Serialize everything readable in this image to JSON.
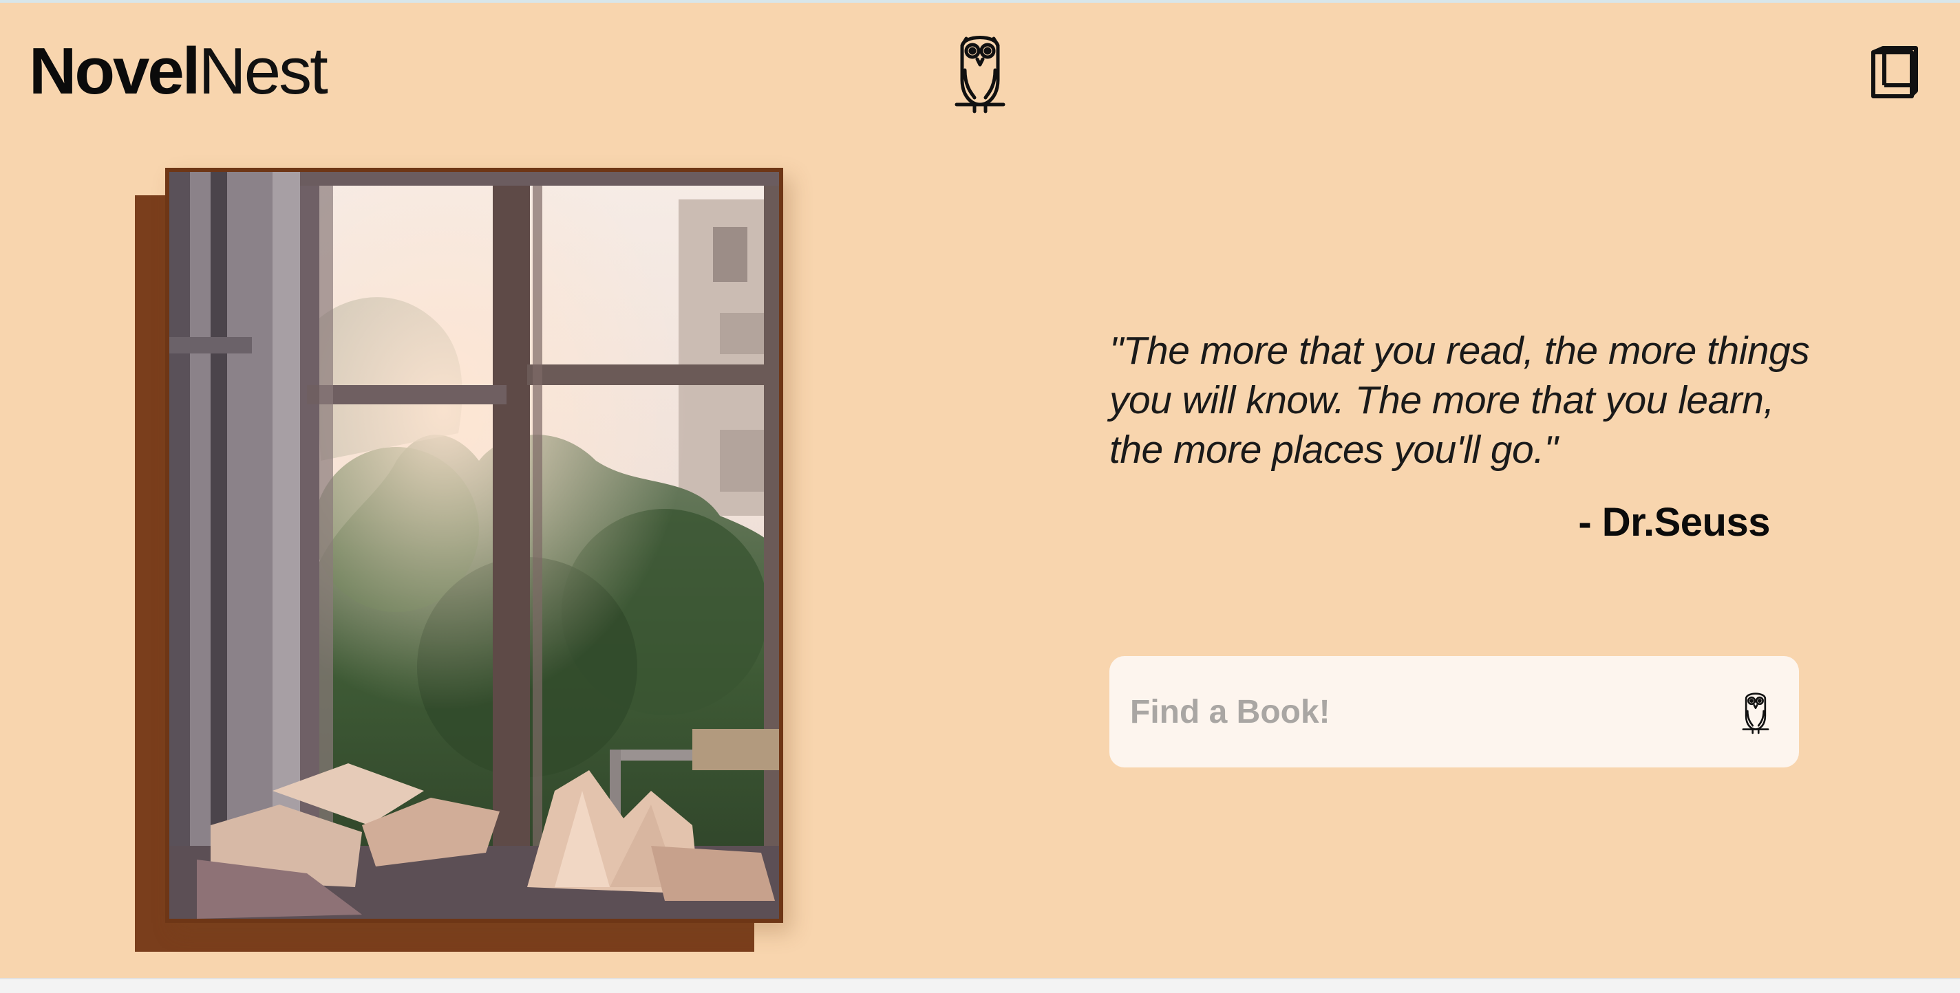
{
  "header": {
    "logo_bold": "Novel",
    "logo_light": "Nest",
    "center_icon": "owl-icon",
    "right_icon": "book-icon"
  },
  "hero": {
    "image_alt": "Open books on a windowsill in front of a window overlooking trees"
  },
  "quote": {
    "text": "\"The more that you read, the more things you will know. The more that you learn, the more places you'll go.\"",
    "author": "- Dr.Seuss"
  },
  "search": {
    "placeholder": "Find a Book!",
    "value": "",
    "button_icon": "owl-icon"
  },
  "colors": {
    "background": "#f8d5ae",
    "accent_brown": "#7a3e1c",
    "search_bg": "#fdf5ee",
    "text": "#0b0b0b"
  }
}
